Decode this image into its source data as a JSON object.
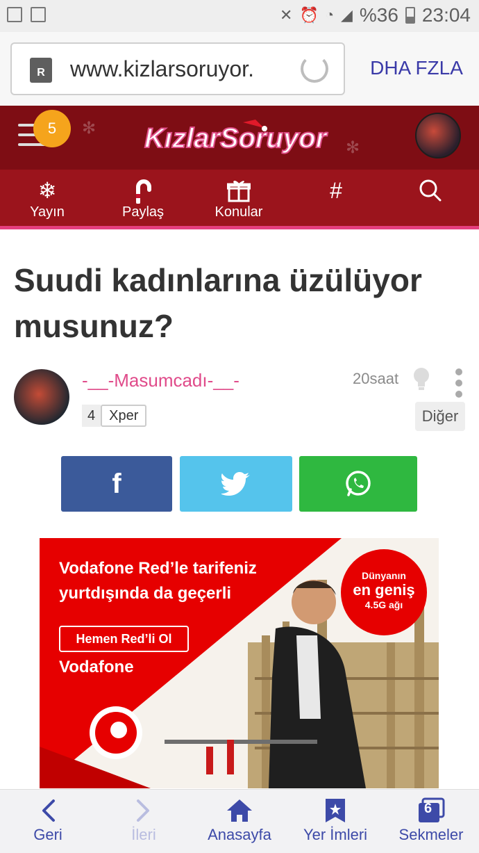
{
  "status_bar": {
    "battery": "%36",
    "time": "23:04",
    "icons": [
      "image-icon",
      "store-icon",
      "mute-icon",
      "alarm-icon",
      "wifi-icon",
      "signal-icon",
      "battery-icon"
    ]
  },
  "browser": {
    "url": "www.kizlarsoruyor.",
    "more_label": "DHA FZLA"
  },
  "site": {
    "logo_text": "KızlarSoruyor",
    "notification_count": "5",
    "nav": [
      {
        "label": "Yayın",
        "icon": "snowflake-icon"
      },
      {
        "label": "Paylaş",
        "icon": "candy-cane-icon"
      },
      {
        "label": "Konular",
        "icon": "gift-icon"
      },
      {
        "label": "#",
        "icon": "hashtag-icon"
      },
      {
        "label": "",
        "icon": "search-icon"
      }
    ]
  },
  "article": {
    "title": "Suudi kadınlarına üzülüyor musunuz?",
    "author": "-__-Masumcadı-__-",
    "level": "4",
    "level_label": "Xper",
    "time": "20saat",
    "other_label": "Diğer"
  },
  "share": {
    "facebook_icon": "f",
    "colors": {
      "facebook": "#3b5a9a",
      "twitter": "#55c4ec",
      "whatsapp": "#2fb840"
    }
  },
  "ad": {
    "headline_line1": "Vodafone Red’le tarifeniz",
    "headline_line2": "yurtdışında da geçerli",
    "cta": "Hemen Red’li Ol",
    "brand": "Vodafone",
    "badge_line1": "Dünyanın",
    "badge_line2": "en geniş",
    "badge_line3": "4.5G ağı"
  },
  "bottom_bar": {
    "back": "Geri",
    "forward": "İleri",
    "home": "Anasayfa",
    "bookmarks": "Yer İmleri",
    "tabs": "Sekmeler",
    "tab_count": "6"
  }
}
